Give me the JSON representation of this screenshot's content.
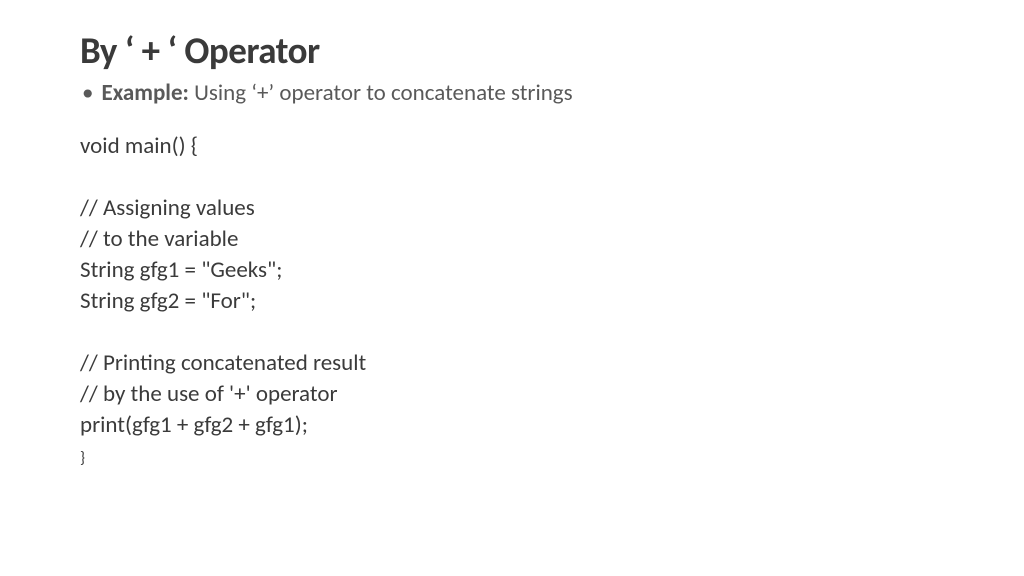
{
  "title": "By ‘ + ‘ Operator",
  "example": {
    "label": "Example:",
    "text": " Using ‘+’ operator to concatenate strings"
  },
  "code": {
    "line1": "void main() {",
    "blank1": "",
    "line2": "// Assigning values",
    "line3": "// to the variable",
    "line4": "String gfg1 = \"Geeks\";",
    "line5": "String gfg2 = \"For\";",
    "blank2": "",
    "line6": "// Printing concatenated result",
    "line7": "// by the use of '+' operator",
    "line8": "print(gfg1 + gfg2 + gfg1);",
    "line9": "}"
  }
}
